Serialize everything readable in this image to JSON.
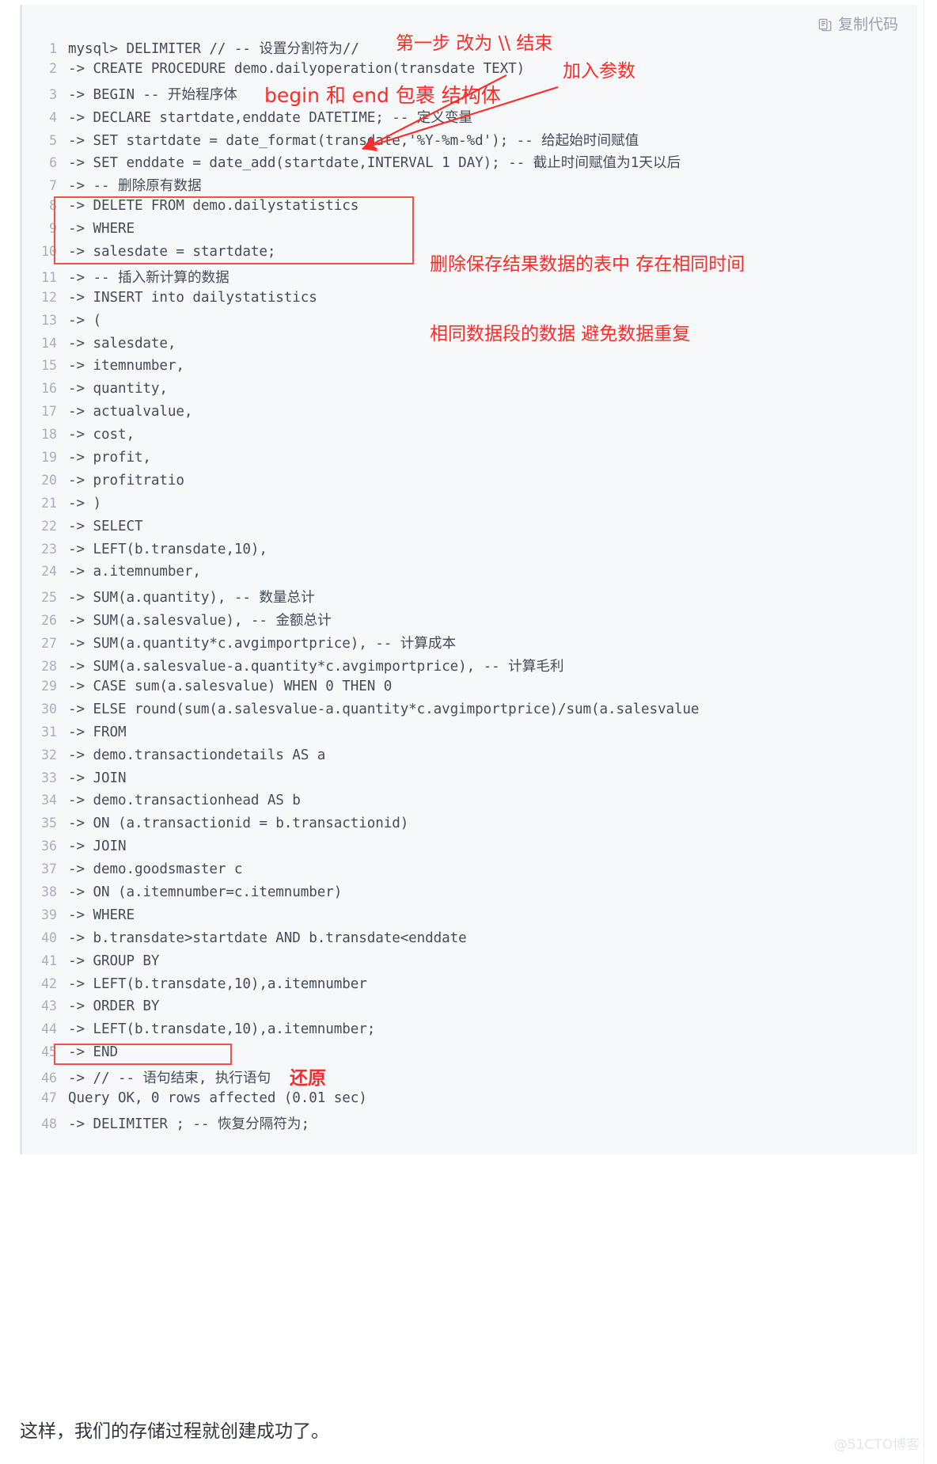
{
  "copy_button": {
    "label": "复制代码",
    "icon": "copy-icon"
  },
  "code": {
    "language": "mysql-console",
    "lines": [
      {
        "n": "1",
        "text": "mysql> DELIMITER // -- 设置分割符为//"
      },
      {
        "n": "2",
        "text": "-> CREATE PROCEDURE demo.dailyoperation(transdate TEXT)"
      },
      {
        "n": "3",
        "text": "-> BEGIN -- 开始程序体"
      },
      {
        "n": "4",
        "text": "-> DECLARE startdate,enddate DATETIME; -- 定义变量"
      },
      {
        "n": "5",
        "text": "-> SET startdate = date_format(transdate,'%Y-%m-%d'); -- 给起始时间赋值"
      },
      {
        "n": "6",
        "text": "-> SET enddate = date_add(startdate,INTERVAL 1 DAY); -- 截止时间赋值为1天以后"
      },
      {
        "n": "7",
        "text": "-> -- 删除原有数据"
      },
      {
        "n": "8",
        "text": "-> DELETE FROM demo.dailystatistics"
      },
      {
        "n": "9",
        "text": "-> WHERE"
      },
      {
        "n": "10",
        "text": "-> salesdate = startdate;"
      },
      {
        "n": "11",
        "text": "-> -- 插入新计算的数据"
      },
      {
        "n": "12",
        "text": "-> INSERT into dailystatistics"
      },
      {
        "n": "13",
        "text": "-> ("
      },
      {
        "n": "14",
        "text": "-> salesdate,"
      },
      {
        "n": "15",
        "text": "-> itemnumber,"
      },
      {
        "n": "16",
        "text": "-> quantity,"
      },
      {
        "n": "17",
        "text": "-> actualvalue,"
      },
      {
        "n": "18",
        "text": "-> cost,"
      },
      {
        "n": "19",
        "text": "-> profit,"
      },
      {
        "n": "20",
        "text": "-> profitratio"
      },
      {
        "n": "21",
        "text": "-> )"
      },
      {
        "n": "22",
        "text": "-> SELECT"
      },
      {
        "n": "23",
        "text": "-> LEFT(b.transdate,10),"
      },
      {
        "n": "24",
        "text": "-> a.itemnumber,"
      },
      {
        "n": "25",
        "text": "-> SUM(a.quantity), -- 数量总计"
      },
      {
        "n": "26",
        "text": "-> SUM(a.salesvalue), -- 金额总计"
      },
      {
        "n": "27",
        "text": "-> SUM(a.quantity*c.avgimportprice), -- 计算成本"
      },
      {
        "n": "28",
        "text": "-> SUM(a.salesvalue-a.quantity*c.avgimportprice), -- 计算毛利"
      },
      {
        "n": "29",
        "text": "-> CASE sum(a.salesvalue) WHEN 0 THEN 0"
      },
      {
        "n": "30",
        "text": "-> ELSE round(sum(a.salesvalue-a.quantity*c.avgimportprice)/sum(a.salesvalue"
      },
      {
        "n": "31",
        "text": "-> FROM"
      },
      {
        "n": "32",
        "text": "-> demo.transactiondetails AS a"
      },
      {
        "n": "33",
        "text": "-> JOIN"
      },
      {
        "n": "34",
        "text": "-> demo.transactionhead AS b"
      },
      {
        "n": "35",
        "text": "-> ON (a.transactionid = b.transactionid)"
      },
      {
        "n": "36",
        "text": "-> JOIN"
      },
      {
        "n": "37",
        "text": "-> demo.goodsmaster c"
      },
      {
        "n": "38",
        "text": "-> ON (a.itemnumber=c.itemnumber)"
      },
      {
        "n": "39",
        "text": "-> WHERE"
      },
      {
        "n": "40",
        "text": "-> b.transdate>startdate AND b.transdate<enddate"
      },
      {
        "n": "41",
        "text": "-> GROUP BY"
      },
      {
        "n": "42",
        "text": "-> LEFT(b.transdate,10),a.itemnumber"
      },
      {
        "n": "43",
        "text": "-> ORDER BY"
      },
      {
        "n": "44",
        "text": "-> LEFT(b.transdate,10),a.itemnumber;"
      },
      {
        "n": "45",
        "text": "-> END"
      },
      {
        "n": "46",
        "text": "-> // -- 语句结束, 执行语句"
      },
      {
        "n": "47",
        "text": "Query OK, 0 rows affected (0.01 sec)"
      },
      {
        "n": "48",
        "text": "-> DELIMITER ; -- 恢复分隔符为;"
      }
    ]
  },
  "annotations": {
    "step1": "第一步 改为 \\\\ 结束",
    "param": "加入参数",
    "begin_end": "begin 和 end 包裹 结构体",
    "delete_note_line1": "删除保存结果数据的表中 存在相同时间",
    "delete_note_line2": "相同数据段的数据 避免数据重复",
    "restore": "还原"
  },
  "footer": {
    "text": "这样，我们的存储过程就创建成功了。",
    "watermark": "@51CTO博客"
  },
  "colors": {
    "annotation_red": "#ff2b26",
    "box_red": "#f4504a",
    "code_bg": "#f7f8fa",
    "line_number": "#a8aebb",
    "code_text": "#454b57"
  }
}
